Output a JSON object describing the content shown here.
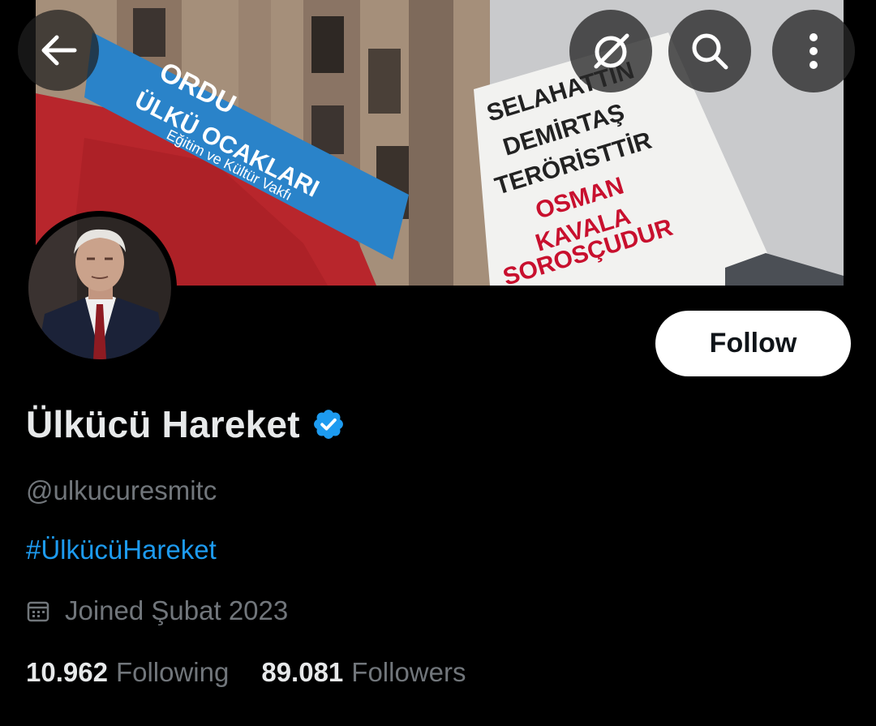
{
  "header": {
    "back_icon": "arrow-left-icon",
    "grok_icon": "grok-slash-circle-icon",
    "search_icon": "search-icon",
    "more_icon": "more-vertical-icon"
  },
  "banner": {
    "sign_line1": "ORDU",
    "sign_line2": "ÜLKÜ OCAKLARI",
    "sign_line3": "Eğitim ve Kültür Vakfı",
    "banner_line1": "SELAHATTİN",
    "banner_line2": "DEMİRTAŞ",
    "banner_line3": "TERÖRİSTTİR",
    "banner_line4": "OSMAN",
    "banner_line5": "KAVALA",
    "banner_line6": "SOROSÇUDUR"
  },
  "profile": {
    "display_name": "Ülkücü Hareket",
    "handle": "@ulkucuresmitc",
    "bio": "#ÜlkücüHareket",
    "joined": "Joined Şubat 2023",
    "verified": true
  },
  "follow_button": {
    "label": "Follow"
  },
  "stats": {
    "following_count": "10.962",
    "following_label": "Following",
    "followers_count": "89.081",
    "followers_label": "Followers"
  },
  "colors": {
    "background": "#000000",
    "text_primary": "#e7e9ea",
    "text_secondary": "#71767b",
    "accent": "#1d9bf0",
    "follow_bg": "#ffffff"
  }
}
